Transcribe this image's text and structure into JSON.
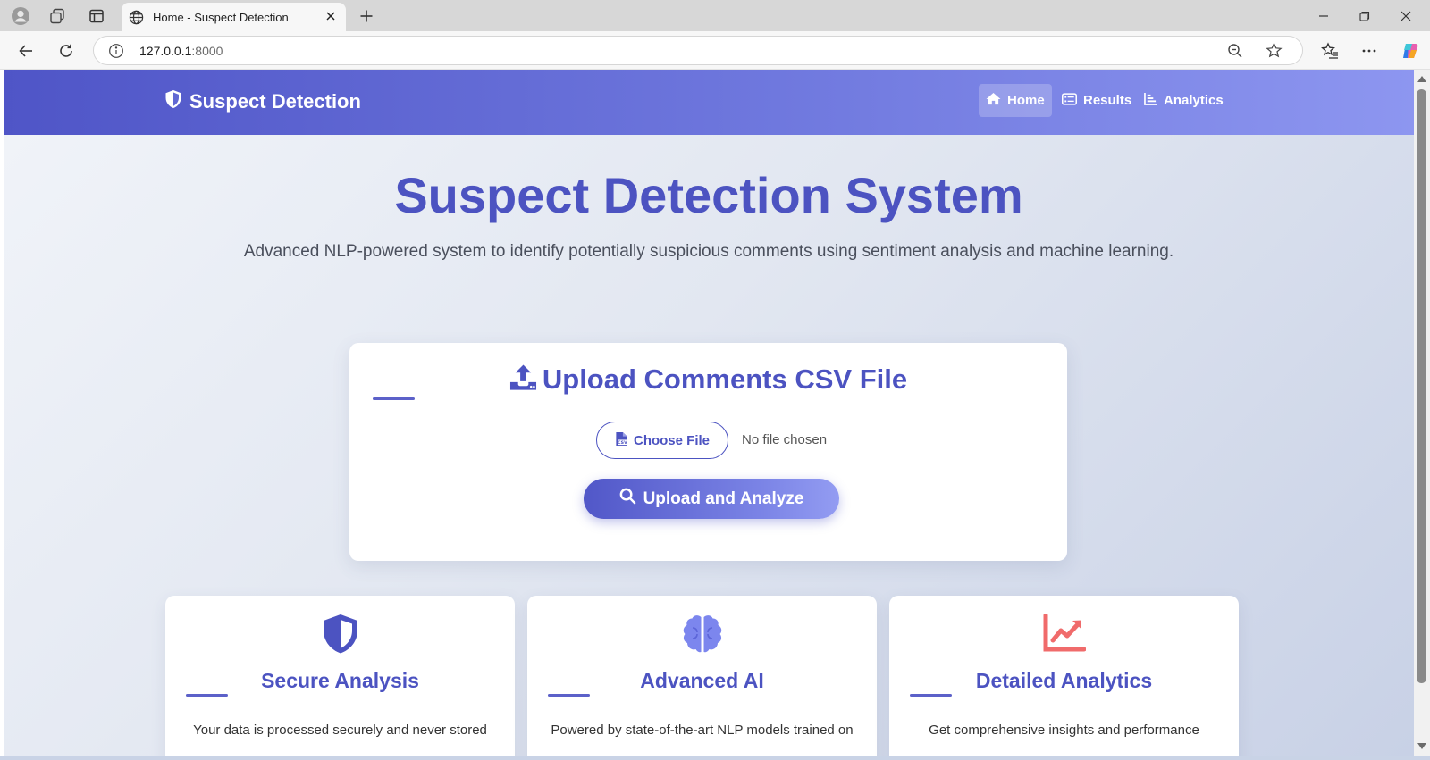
{
  "browser": {
    "tab_title": "Home - Suspect Detection",
    "url_host": "127.0.0.1",
    "url_port": ":8000"
  },
  "navbar": {
    "brand": "Suspect Detection",
    "links": [
      {
        "label": "Home",
        "icon": "home-icon",
        "active": true
      },
      {
        "label": "Results",
        "icon": "list-icon",
        "active": false
      },
      {
        "label": "Analytics",
        "icon": "bar-chart-icon",
        "active": false
      }
    ]
  },
  "hero": {
    "title": "Suspect Detection System",
    "subtitle": "Advanced NLP-powered system to identify potentially suspicious comments using sentiment analysis and machine learning."
  },
  "upload": {
    "title": "Upload Comments CSV File",
    "choose_label": "Choose File",
    "file_status": "No file chosen",
    "submit_label": "Upload and Analyze"
  },
  "features": [
    {
      "title": "Secure Analysis",
      "icon": "shield-icon",
      "description": "Your data is processed securely and never stored"
    },
    {
      "title": "Advanced AI",
      "icon": "brain-icon",
      "description": "Powered by state-of-the-art NLP models trained on"
    },
    {
      "title": "Detailed Analytics",
      "icon": "chart-line-icon",
      "description": "Get comprehensive insights and performance"
    }
  ],
  "colors": {
    "primary": "#4c53c1",
    "nav_gradient_start": "#4f55c7",
    "nav_gradient_end": "#8d96f0",
    "brain_icon": "#7c86ee",
    "analytics_icon": "#f06b6b"
  }
}
